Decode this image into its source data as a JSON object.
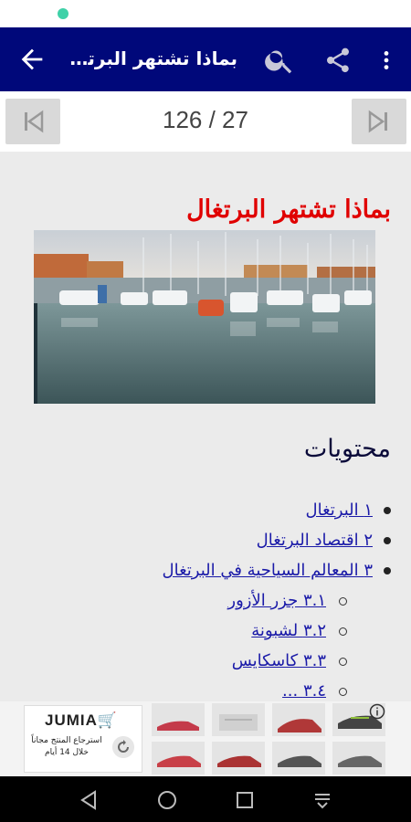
{
  "app_bar": {
    "title": "بماذا تشتهر البرتغ...",
    "icons": [
      "back-arrow-icon",
      "search-icon",
      "share-icon",
      "more-vert-icon"
    ]
  },
  "pager": {
    "current": "27",
    "total": "126",
    "display": "126 / 27"
  },
  "article": {
    "title": "بماذا تشتهر البرتغال",
    "toc_heading": "محتويات",
    "toc": [
      {
        "label": "١ البرتغال",
        "level": 1
      },
      {
        "label": "٢ اقتصاد البرتغال",
        "level": 1
      },
      {
        "label": "٣ المعالم السياحية في البرتغال",
        "level": 1
      },
      {
        "label": "٣.١ جزر الأزور",
        "level": 2
      },
      {
        "label": "٣.٢ لشبونة",
        "level": 2
      },
      {
        "label": "٣.٣ كاسكايس",
        "level": 2
      },
      {
        "label": "٣.٤ ...",
        "level": 2
      }
    ]
  },
  "ad": {
    "brand": "JUMIA",
    "promo_line1": "استرجاع المنتج مجاناً",
    "promo_line2": "خلال 14 أيام"
  },
  "colors": {
    "app_bar": "#00087a",
    "article_title": "#e00000",
    "link": "#1a1aa8",
    "background": "#ebebeb"
  }
}
